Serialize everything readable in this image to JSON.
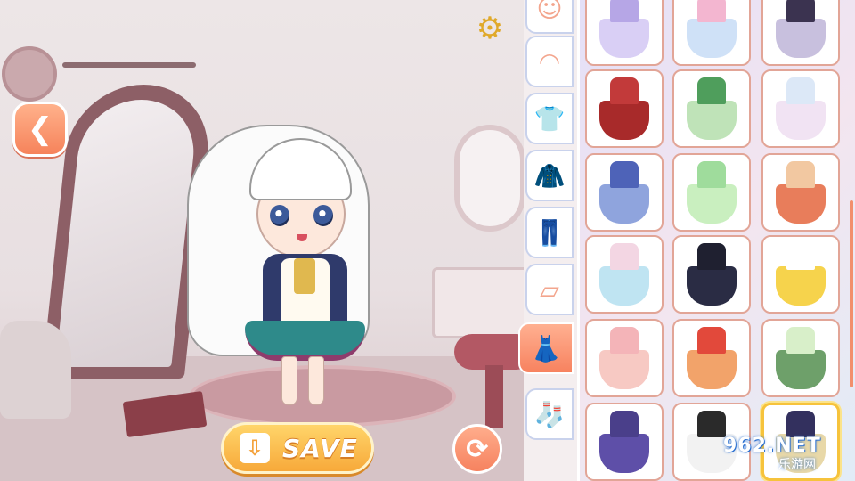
{
  "toolbar": {
    "save_label": "SAVE",
    "back_icon": "back-arrow-icon",
    "settings_icon": "gear-icon",
    "refresh_icon": "refresh-icon",
    "save_icon": "download-icon"
  },
  "categories": [
    {
      "name": "expression",
      "icon": "face-smile-icon",
      "glyph": "☺"
    },
    {
      "name": "face",
      "icon": "face-blank-icon",
      "glyph": "◠"
    },
    {
      "name": "top",
      "icon": "tanktop-icon",
      "glyph": "👕"
    },
    {
      "name": "jacket",
      "icon": "jacket-icon",
      "glyph": "🧥"
    },
    {
      "name": "pants",
      "icon": "pants-icon",
      "glyph": "👖"
    },
    {
      "name": "skirt",
      "icon": "skirt-icon",
      "glyph": "▱"
    },
    {
      "name": "dress",
      "icon": "dress-icon",
      "glyph": "👗",
      "active": true
    },
    {
      "name": "socks",
      "icon": "sock-icon",
      "glyph": "🧦"
    }
  ],
  "items": [
    {
      "top": "#b6a6e6",
      "skirt": "#d9cff5"
    },
    {
      "top": "#f3b6d0",
      "skirt": "#cfe1f7"
    },
    {
      "top": "#3b3350",
      "skirt": "#c8c0de"
    },
    {
      "top": "#c23a3a",
      "skirt": "#a82a2a"
    },
    {
      "top": "#4f9e5c",
      "skirt": "#bfe3b8"
    },
    {
      "top": "#dce8f7",
      "skirt": "#f1e3f3"
    },
    {
      "top": "#4e63b8",
      "skirt": "#8fa4dd"
    },
    {
      "top": "#9fdc9c",
      "skirt": "#c9efbf"
    },
    {
      "top": "#f2c8a1",
      "skirt": "#e87d5b"
    },
    {
      "top": "#f3d6e3",
      "skirt": "#bfe4f2"
    },
    {
      "top": "#1f2030",
      "skirt": "#2a2c44"
    },
    {
      "top": "#ffffff",
      "skirt": "#f6d34c"
    },
    {
      "top": "#f4b4b8",
      "skirt": "#f7c9c3"
    },
    {
      "top": "#e2493b",
      "skirt": "#f2a36a"
    },
    {
      "top": "#d8efc9",
      "skirt": "#6ea06a"
    },
    {
      "top": "#4a3f8a",
      "skirt": "#5e4fa8"
    },
    {
      "top": "#2a2a2a",
      "skirt": "#f2f2f2"
    },
    {
      "top": "#33305e",
      "skirt": "#e8d8a8",
      "selected": true
    }
  ],
  "watermark": {
    "top": "962.NET",
    "bottom": "乐游网"
  },
  "colors": {
    "accent": "#f7825f",
    "save": "#f7a93a",
    "selected_border": "#f6c33c"
  }
}
